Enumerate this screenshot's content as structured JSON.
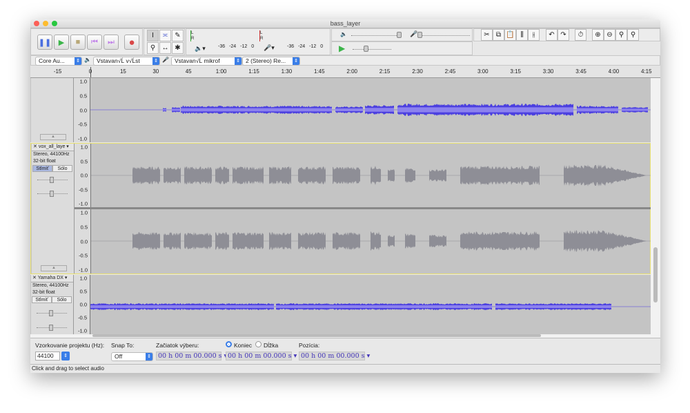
{
  "window": {
    "title": "bass_layer"
  },
  "transport": {
    "buttons": [
      "pause",
      "play",
      "stop",
      "skip-start",
      "skip-end",
      "record"
    ]
  },
  "meters": {
    "ticks": [
      "-36",
      "-24",
      "-12",
      "0"
    ],
    "L": "L",
    "R": "R"
  },
  "devices": {
    "host": "Core Au...",
    "output": "Vstavan√Ĺ v√Ĺst",
    "input": "Vstavan√Ĺ mikrof",
    "channels": "2 (Stereo) Re..."
  },
  "ruler": {
    "labels": [
      "-15",
      "0",
      "15",
      "30",
      "45",
      "1:00",
      "1:15",
      "1:30",
      "1:45",
      "2:00",
      "2:15",
      "2:30",
      "2:45",
      "3:00",
      "3:15",
      "3:30",
      "3:45",
      "4:00",
      "4:15"
    ]
  },
  "scale": [
    "1.0",
    "0.5",
    "0.0",
    "-0.5",
    "-1.0"
  ],
  "tracks": [
    {
      "name": "vox_all_laye",
      "info1": "Stereo, 44100Hz",
      "info2": "32-bit float",
      "mute": "Stlmiť",
      "solo": "Sólo"
    },
    {
      "name": "Yamaha DX",
      "info1": "Stereo, 44100Hz",
      "info2": "32-bit float",
      "mute": "Stlmiť",
      "solo": "Sólo"
    }
  ],
  "gain": {
    "minus": "-",
    "plus": "+",
    "L": "L",
    "R": "R"
  },
  "bottom": {
    "rate_label": "Vzorkovanie projektu (Hz):",
    "rate": "44100",
    "snap_label": "Snap To:",
    "snap": "Off",
    "start_label": "Začiatok výberu:",
    "end_label": "Koniec",
    "length_label": "Dĺžka",
    "pos_label": "Pozícia:",
    "time1": "00 h 00 m 00.000 s",
    "time2": "00 h 00 m 00.000 s",
    "time3": "00 h 00 m 00.000 s"
  },
  "status": "Click and drag to select audio",
  "colors": {
    "wave_blue": "#4b3fe0",
    "wave_grey": "#8e8e96",
    "selected_border": "#e8e070"
  }
}
